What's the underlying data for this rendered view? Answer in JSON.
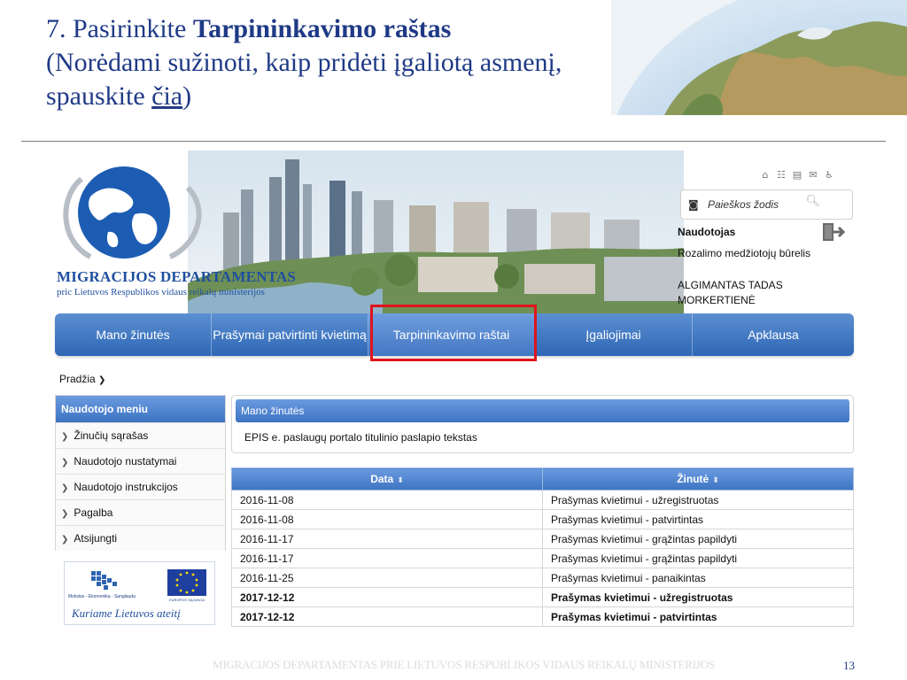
{
  "slide": {
    "title_prefix": "7. Pasirinkite ",
    "title_bold": "Tarpininkavimo raštas",
    "title_line2": "(Norėdami sužinoti, kaip pridėti įgaliotą asmenį,",
    "title_line3_pre": "spauskite ",
    "title_link": "čia",
    "title_line3_post": ")",
    "footer": "MIGRACIJOS DEPARTAMENTAS PRIE LIETUVOS RESPUBLIKOS VIDAUS REIKALŲ MINISTERIJOS",
    "page_number": "13"
  },
  "header": {
    "org_name": "MIGRACIJOS DEPARTAMENTAS",
    "org_subtitle": "pric Lietuvos Respublikos vidaus reikalų ministerijos",
    "search_placeholder": "Paieškos žodis",
    "user_label": "Naudotojas",
    "user_lines": [
      "Rozalimo medžiotojų būrelis",
      "ALGIMANTAS TADAS",
      "MORKERTIENĖ"
    ],
    "util_icons": [
      "home-icon",
      "sitemap-icon",
      "print-icon",
      "mail-icon",
      "accessibility-icon"
    ]
  },
  "nav": {
    "items": [
      "Mano žinutės",
      "Prašymai patvirtinti kvietimą",
      "Tarpininkavimo raštai",
      "Įgaliojimai",
      "Apklausa"
    ],
    "active_index": 2,
    "highlight_color": "#e0131b"
  },
  "breadcrumb": "Pradžia",
  "sidebar": {
    "title": "Naudotojo meniu",
    "items": [
      "Žinučių sąrašas",
      "Naudotojo nustatymai",
      "Naudotojo instrukcijos",
      "Pagalba",
      "Atsijungti"
    ]
  },
  "eu_banner": {
    "slogan": "Kuriame Lietuvos ateitį",
    "small_text": "Mokslas - Ekonomika - Sanglauda",
    "flag_text": "EUROPOS SĄJUNGA"
  },
  "news": {
    "title": "Mano žinutės",
    "body": "EPIS e. paslaugų portalo titulinio paslapio tekstas"
  },
  "messages_table": {
    "headers": [
      "Data",
      "Žinutė"
    ],
    "rows": [
      {
        "date": "2016-11-08",
        "message": "Prašymas kvietimui - užregistruotas",
        "bold": false
      },
      {
        "date": "2016-11-08",
        "message": "Prašymas kvietimui - patvirtintas",
        "bold": false
      },
      {
        "date": "2016-11-17",
        "message": "Prašymas kvietimui - grąžintas papildyti",
        "bold": false
      },
      {
        "date": "2016-11-17",
        "message": "Prašymas kvietimui - grąžintas papildyti",
        "bold": false
      },
      {
        "date": "2016-11-25",
        "message": "Prašymas kvietimui - panaikintas",
        "bold": false
      },
      {
        "date": "2017-12-12",
        "message": "Prašymas kvietimui - užregistruotas",
        "bold": true
      },
      {
        "date": "2017-12-12",
        "message": "Prašymas kvietimui - patvirtintas",
        "bold": true
      }
    ]
  },
  "colors": {
    "nav_blue": "#2f67b6",
    "title_blue": "#1f3a86",
    "highlight_red": "#e0131b"
  }
}
